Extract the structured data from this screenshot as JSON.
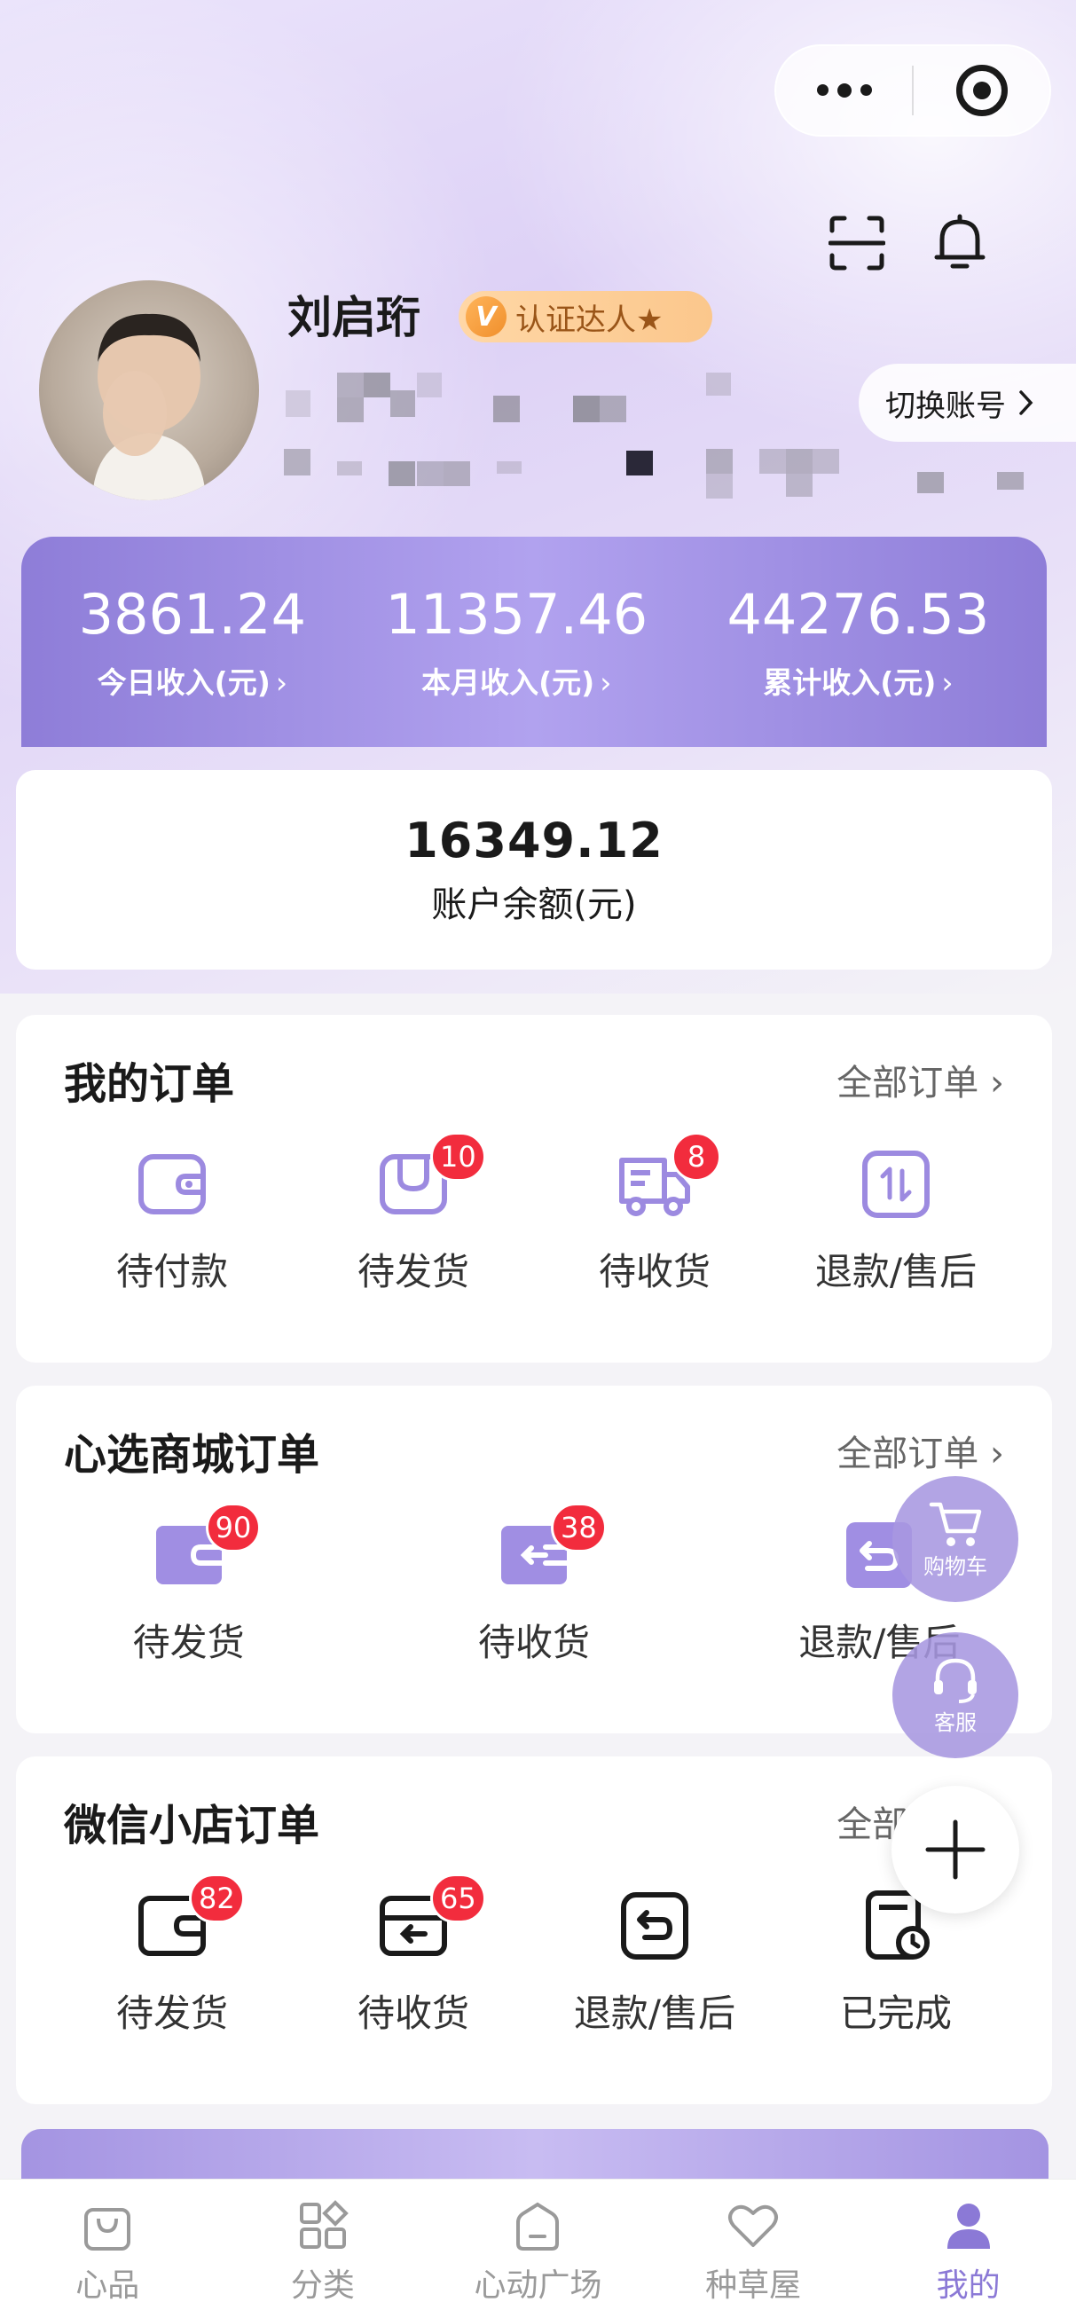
{
  "profile": {
    "name": "刘启珩",
    "badge": "认证达人★",
    "badge_icon": "V",
    "switch_label": "切换账号"
  },
  "income": [
    {
      "value": "3861.24",
      "label": "今日收入(元)"
    },
    {
      "value": "11357.46",
      "label": "本月收入(元)"
    },
    {
      "value": "44276.53",
      "label": "累计收入(元)"
    }
  ],
  "balance": {
    "value": "16349.12",
    "label": "账户余额(元)"
  },
  "my_orders": {
    "title": "我的订单",
    "all": "全部订单",
    "items": [
      {
        "label": "待付款",
        "icon": "wallet-icon",
        "count": ""
      },
      {
        "label": "待发货",
        "icon": "box-icon",
        "count": "10"
      },
      {
        "label": "待收货",
        "icon": "truck-icon",
        "count": "8"
      },
      {
        "label": "退款/售后",
        "icon": "refund-icon",
        "count": ""
      }
    ]
  },
  "mall_orders": {
    "title": "心选商城订单",
    "all": "全部订单",
    "items": [
      {
        "label": "待发货",
        "icon": "wallet-icon",
        "count": "90"
      },
      {
        "label": "待收货",
        "icon": "receive-icon",
        "count": "38"
      },
      {
        "label": "退款/售后",
        "icon": "return-icon",
        "count": ""
      }
    ]
  },
  "wechat_orders": {
    "title": "微信小店订单",
    "all": "全部订单",
    "items": [
      {
        "label": "待发货",
        "icon": "wallet-icon",
        "count": "82"
      },
      {
        "label": "待收货",
        "icon": "receive-icon",
        "count": "65"
      },
      {
        "label": "退款/售后",
        "icon": "return-icon",
        "count": ""
      },
      {
        "label": "已完成",
        "icon": "done-icon",
        "count": ""
      }
    ]
  },
  "floating": {
    "cart": "购物车",
    "service": "客服"
  },
  "tabbar": [
    {
      "label": "心品",
      "icon": "bag-icon"
    },
    {
      "label": "分类",
      "icon": "category-icon"
    },
    {
      "label": "心动广场",
      "icon": "home-icon"
    },
    {
      "label": "种草屋",
      "icon": "heart-icon"
    },
    {
      "label": "我的",
      "icon": "user-icon"
    }
  ],
  "colors": {
    "accent": "#8b79d6",
    "badge_red": "#f22c3d"
  }
}
